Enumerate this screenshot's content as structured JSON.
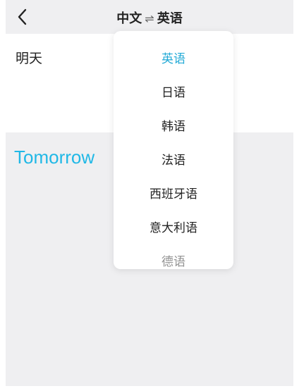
{
  "header": {
    "source_lang": "中文",
    "swap_symbol": "⇌",
    "target_lang": "英语"
  },
  "source": {
    "text": "明天"
  },
  "result": {
    "text": "Tomorrow"
  },
  "dropdown": {
    "items": [
      {
        "label": "英语"
      },
      {
        "label": "日语"
      },
      {
        "label": "韩语"
      },
      {
        "label": "法语"
      },
      {
        "label": "西班牙语"
      },
      {
        "label": "意大利语"
      },
      {
        "label": "德语"
      }
    ]
  },
  "colors": {
    "accent": "#23aad6",
    "result_text": "#20b8e6",
    "panel_gray": "#efeff1"
  },
  "icons": {
    "back": "chevron-left-icon",
    "swap": "swap-arrows-icon"
  }
}
